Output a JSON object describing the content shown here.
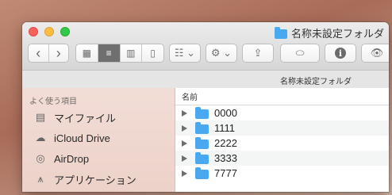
{
  "window": {
    "title": "名称未設定フォルダ",
    "path_label": "名称未設定フォルダ"
  },
  "toolbar": {
    "back_glyph": "‹",
    "forward_glyph": "›",
    "view_icon": "▦",
    "view_list": "≡",
    "view_columns": "▥",
    "view_gallery": "▯",
    "group_glyph": "☷ ⌄",
    "action_glyph": "⚙ ⌄",
    "share_glyph": "⇪",
    "tag_glyph": "⬭",
    "info_glyph": "i",
    "preview_glyph": "👁"
  },
  "sidebar": {
    "heading": "よく使う項目",
    "items": [
      {
        "label": "マイファイル",
        "icon": "all-my-files-icon",
        "glyph": "▤"
      },
      {
        "label": "iCloud Drive",
        "icon": "cloud-icon",
        "glyph": "☁"
      },
      {
        "label": "AirDrop",
        "icon": "airdrop-icon",
        "glyph": "◎"
      },
      {
        "label": "アプリケーション",
        "icon": "applications-icon",
        "glyph": "⩚"
      }
    ]
  },
  "main": {
    "column_header": "名前",
    "rows": [
      {
        "name": "0000"
      },
      {
        "name": "1111"
      },
      {
        "name": "2222"
      },
      {
        "name": "3333"
      },
      {
        "name": "7777"
      }
    ]
  },
  "colors": {
    "accent": "#4aa8f0",
    "close": "#fc605c",
    "minimize": "#fdbc40",
    "maximize": "#34c84a"
  }
}
